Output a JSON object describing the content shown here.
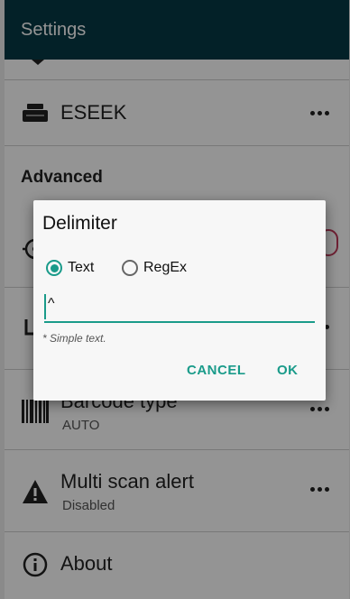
{
  "appbar": {
    "title": "Settings"
  },
  "list": {
    "eseek": {
      "label": "ESEEK"
    },
    "section_advanced": "Advanced",
    "barcode_type": {
      "title": "Barcode type",
      "subtitle": "AUTO"
    },
    "multi_scan_alert": {
      "title": "Multi scan alert",
      "subtitle": "Disabled"
    },
    "about": {
      "label": "About"
    }
  },
  "dialog": {
    "title": "Delimiter",
    "options": [
      {
        "label": "Text",
        "selected": true
      },
      {
        "label": "RegEx",
        "selected": false
      }
    ],
    "input_value": "^",
    "hint": "* Simple text.",
    "cancel_label": "CANCEL",
    "ok_label": "OK"
  },
  "colors": {
    "appbar": "#063a45",
    "accent": "#1a9b8a"
  }
}
